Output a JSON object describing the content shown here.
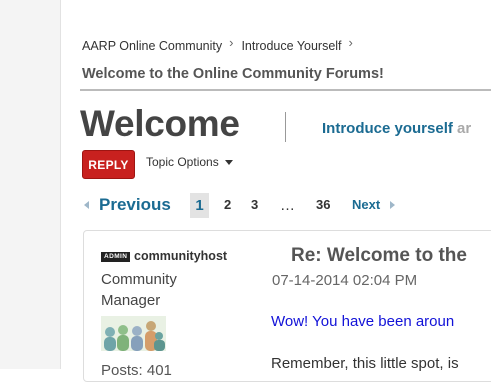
{
  "breadcrumb": {
    "items": [
      "AARP Online Community",
      "Introduce Yourself"
    ]
  },
  "page_title": "Welcome to the Online Community Forums!",
  "thread": {
    "heading": "Welcome",
    "board_link": "Introduce yourself",
    "board_suffix": "ar"
  },
  "actions": {
    "reply_label": "REPLY",
    "topic_options_label": "Topic Options"
  },
  "pagination": {
    "previous_label": "Previous",
    "current_page": "1",
    "pages": [
      "2",
      "3"
    ],
    "ellipsis": "…",
    "last_page": "36",
    "next_label": "Next"
  },
  "post": {
    "badge": "ADMIN",
    "username": "communityhost",
    "rank_line1": "Community",
    "rank_line2": "Manager",
    "posts_partial": "Posts: 401",
    "subject": "Re: Welcome to the",
    "date": "07-14-2014 02:04 PM",
    "body_line1": "Wow! You have been aroun",
    "body_line2": "Remember, this little spot, is"
  },
  "colors": {
    "link": "#1b6b92",
    "reply_button": "#c8211f",
    "body_blue": "#1212d8"
  }
}
